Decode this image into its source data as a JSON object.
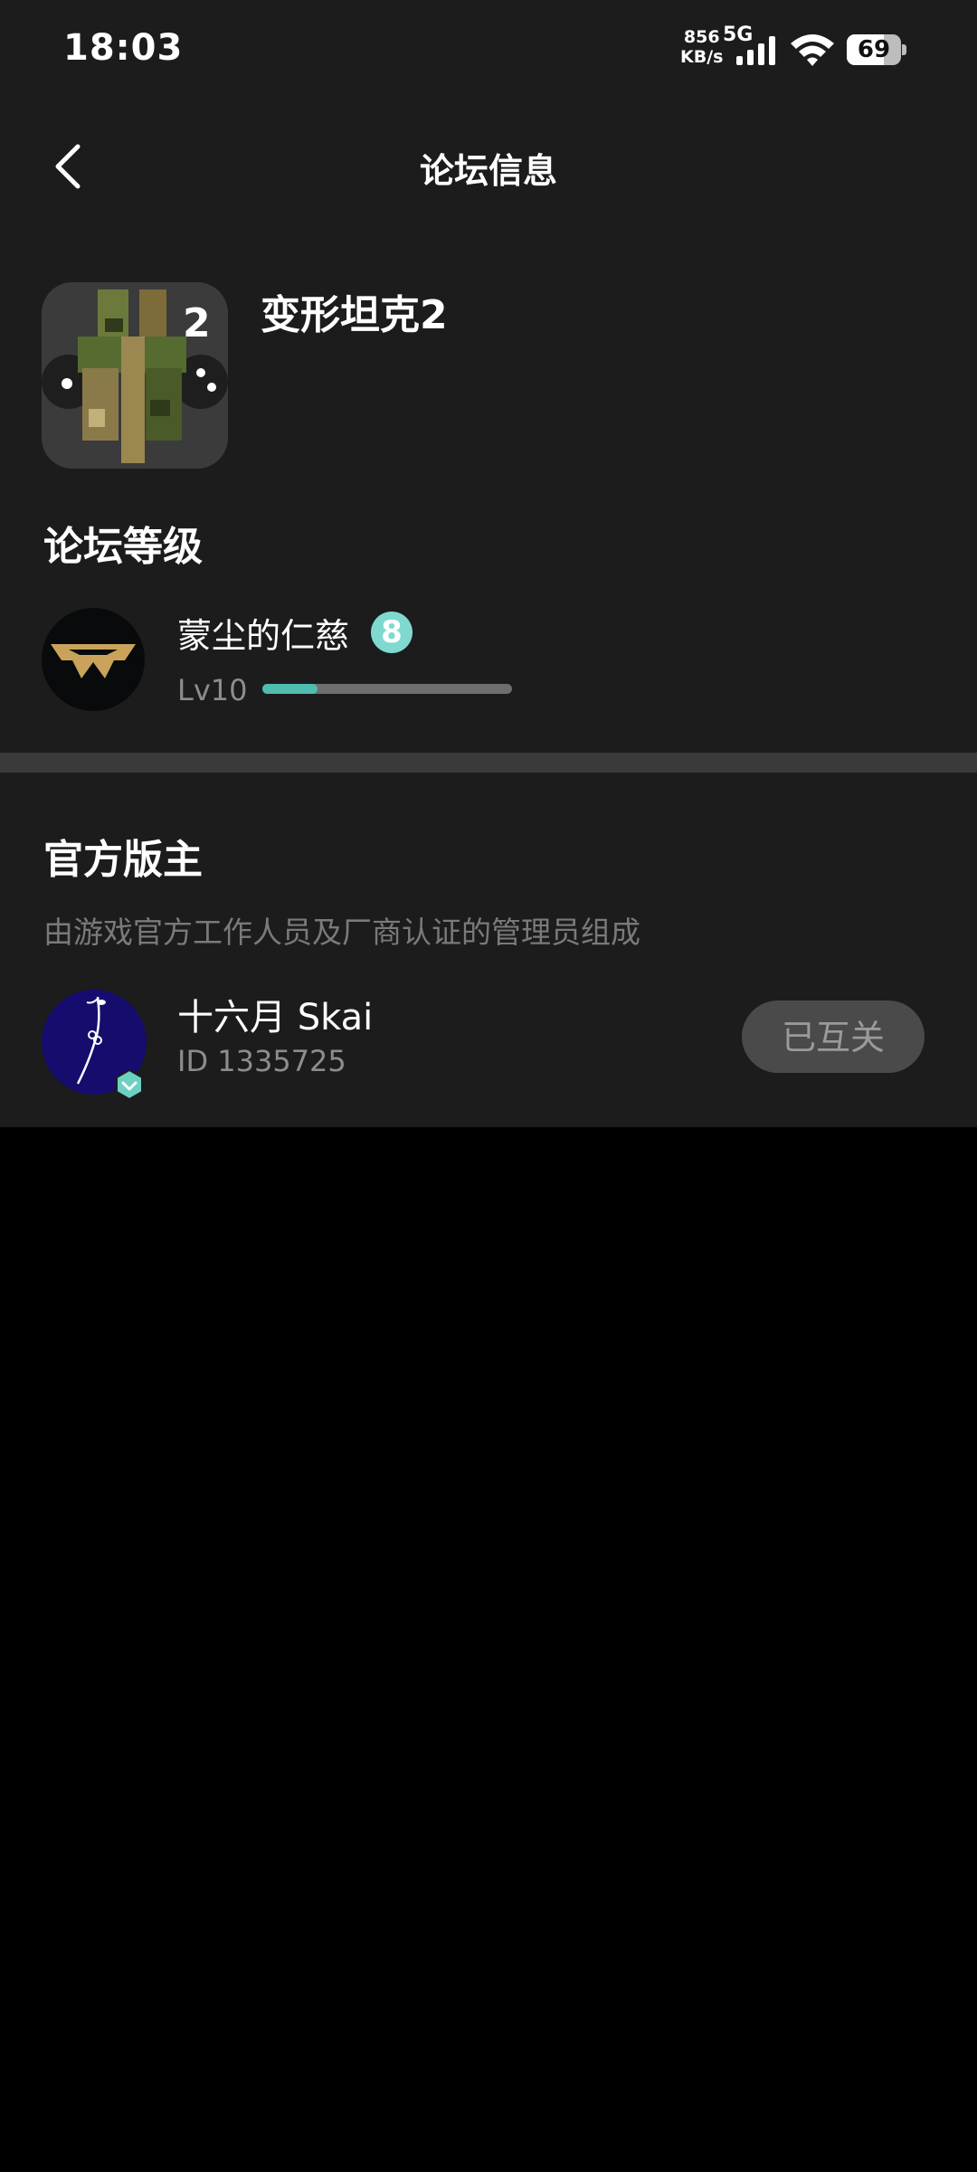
{
  "status_bar": {
    "time": "18:03",
    "net_speed_value": "856",
    "net_speed_unit": "KB/s",
    "network_type": "5G",
    "battery_level": "69"
  },
  "nav": {
    "title": "论坛信息",
    "back_icon": "chevron-left-icon"
  },
  "game": {
    "name": "变形坦克2"
  },
  "forum_level": {
    "title": "论坛等级",
    "user_name": "蒙尘的仁慈",
    "badge_value": "8",
    "level_label": "Lv10",
    "progress_fraction": 0.22,
    "progress_color": "#4fbcae"
  },
  "moderators": {
    "title": "官方版主",
    "description": "由游戏官方工作人员及厂商认证的管理员组成",
    "items": [
      {
        "name": "十六月 Skai",
        "id_text": "ID 1335725",
        "follow_label": "已互关"
      }
    ]
  }
}
